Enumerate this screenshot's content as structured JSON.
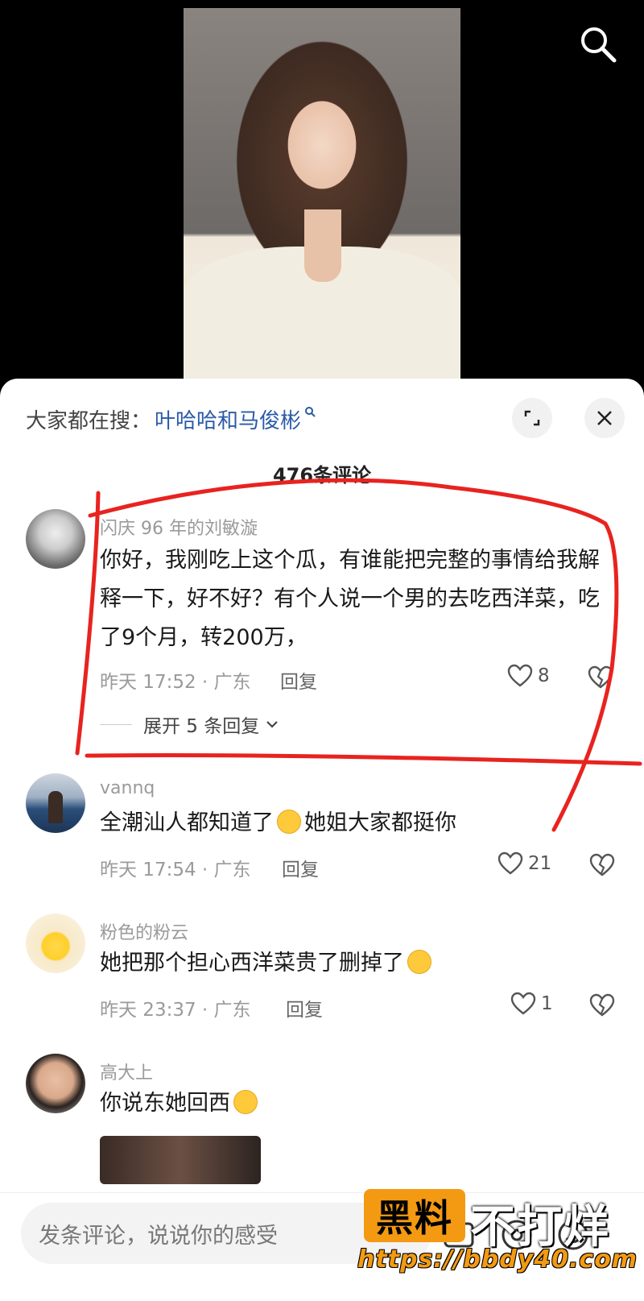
{
  "sheet": {
    "search_prefix": "大家都在搜：",
    "search_term": "叶哈哈和马俊彬",
    "comment_count_title": "476条评论"
  },
  "comments": [
    {
      "user": "闪庆 96 年的刘敏漩",
      "text": "你好，我刚吃上这个瓜，有谁能把完整的事情给我解释一下，好不好？有个人说一个男的去吃西洋菜，吃了9个月，转200万，",
      "time_loc": "昨天 17:52 · 广东",
      "reply_label": "回复",
      "likes": "8",
      "expand_label": "展开 5 条回复"
    },
    {
      "user": "vannq",
      "text_a": "全潮汕人都知道了",
      "text_b": "她姐大家都挺你",
      "time_loc": "昨天 17:54 · 广东",
      "reply_label": "回复",
      "likes": "21"
    },
    {
      "user": "粉色的粉云",
      "text": "她把那个担心西洋菜贵了删掉了",
      "time_loc": "昨天 23:37 · 广东",
      "reply_label": "回复",
      "likes": "1"
    },
    {
      "user": "高大上",
      "text": "你说东她回西"
    }
  ],
  "input_bar": {
    "placeholder": "发条评论，说说你的感受"
  },
  "watermark": {
    "box_text": "黑料",
    "text": "不打烊",
    "url": "https://bbdy40.com"
  },
  "colors": {
    "link_blue": "#2a5aa8",
    "annotation_red": "#e8231f",
    "watermark_orange": "#f39a12"
  }
}
